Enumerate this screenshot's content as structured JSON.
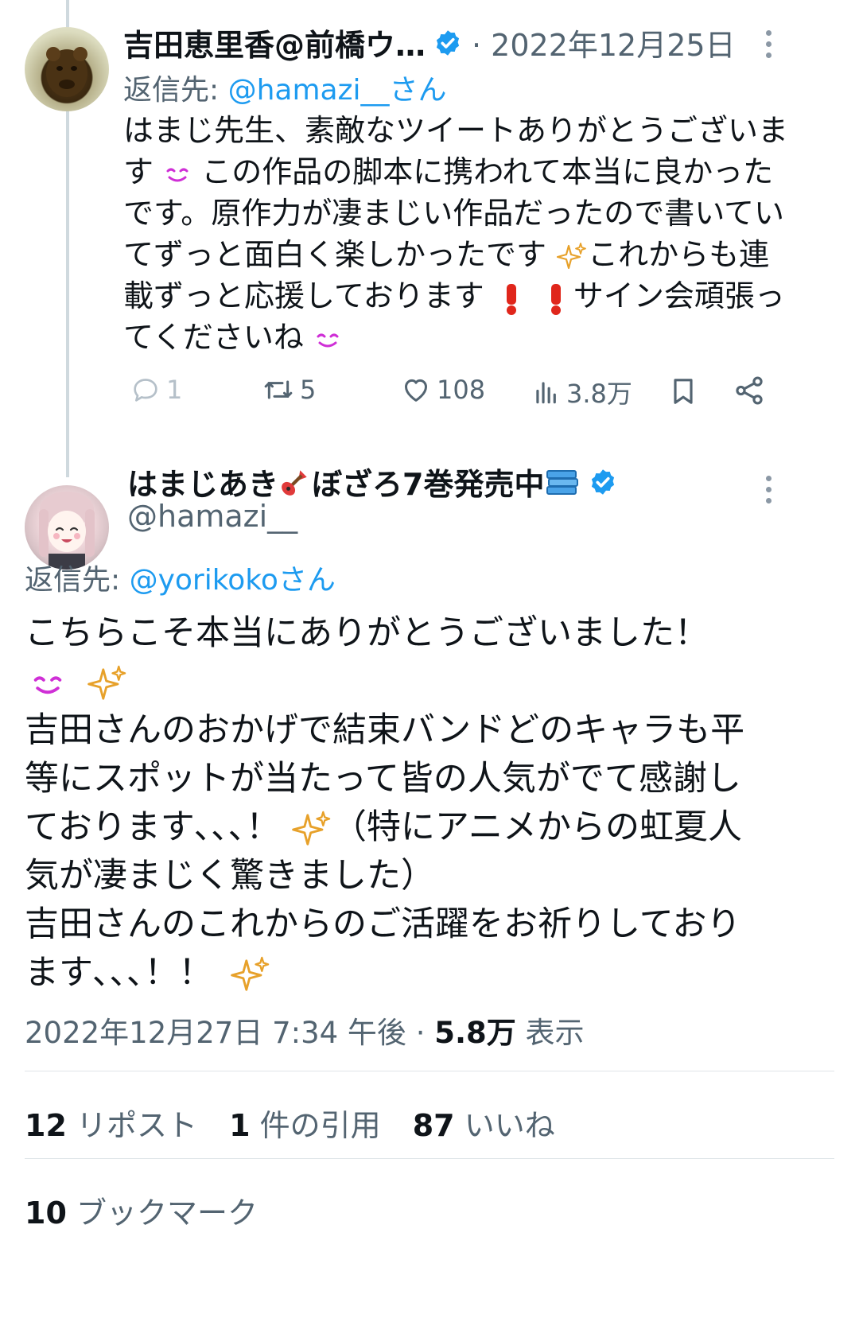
{
  "reply_tweet": {
    "author_name": "吉田恵里香@前橋ウ…",
    "date": "· 2022年12月25日",
    "reply_label": "返信先: ",
    "reply_mention": "@hamazi__さん",
    "lines": [
      "はまじ先生、素敵なツイートありがとうございま",
      "す",
      "この作品の脚本に携われて本当に良かった",
      "です。原作力が凄まじい作品だったので書いてい",
      "てずっと面白く楽しかったです",
      "これからも連",
      "載ずっと応援しております",
      "サイン会頑張っ",
      "てくださいね"
    ],
    "replies": "1",
    "reposts": "5",
    "likes": "108",
    "views": "3.8万"
  },
  "main_tweet": {
    "author_name": "はまじあき",
    "author_name_2": "ぼざろ7巻発売中",
    "handle": "@hamazi__",
    "reply_label": "返信先: ",
    "reply_mention": "@yorikokoさん",
    "lines": [
      "こちらこそ本当にありがとうございました！",
      "吉田さんのおかげで結束バンドどのキャラも平",
      "等にスポットが当たって皆の人気がでて感謝し",
      "ております､､､！",
      "（特にアニメからの虹夏人",
      "気が凄まじく驚きました）",
      "吉田さんのこれからのご活躍をお祈りしており",
      "ます､､､！！"
    ],
    "timestamp": "2022年12月27日 7:34 午後 · ",
    "views_count": "5.8万",
    "views_label": " 表示",
    "reposts_count": "12",
    "reposts_label": " リポスト",
    "quotes_count": "1",
    "quotes_label": " 件の引用",
    "likes_count": "87",
    "likes_label": " いいね",
    "bookmarks_count": "10",
    "bookmarks_label": " ブックマーク"
  },
  "colors": {
    "accent": "#1d9bf0",
    "muted": "#536471",
    "text": "#0f1419"
  }
}
